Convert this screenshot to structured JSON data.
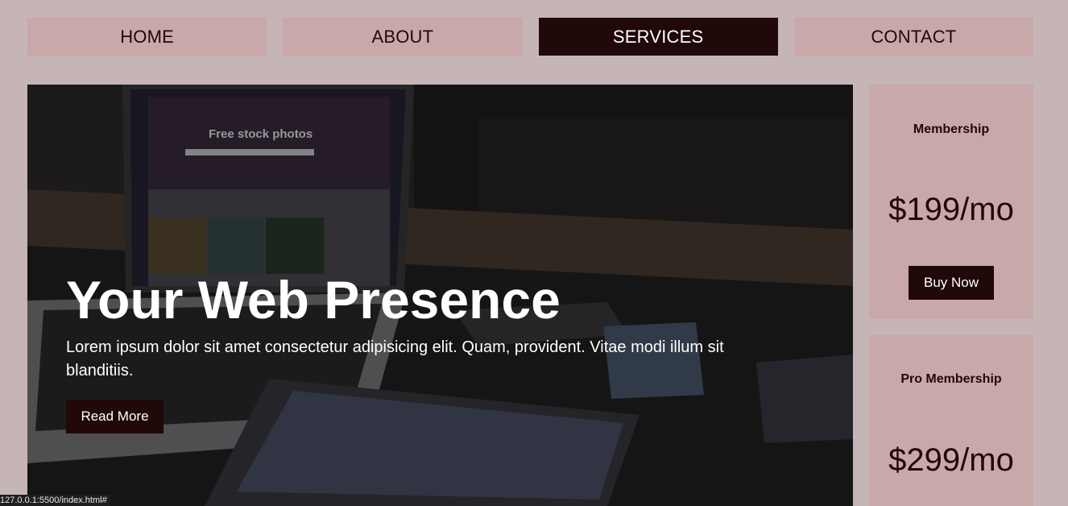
{
  "nav": {
    "items": [
      {
        "label": "HOME",
        "active": false
      },
      {
        "label": "ABOUT",
        "active": false
      },
      {
        "label": "SERVICES",
        "active": true
      },
      {
        "label": "CONTACT",
        "active": false
      }
    ]
  },
  "hero": {
    "title": "Your Web Presence",
    "text": "Lorem ipsum dolor sit amet consectetur adipisicing elit. Quam, provident. Vitae modi illum sit blanditiis.",
    "button_label": "Read More",
    "background_image": "laptop-phone-tablet-desk-photo",
    "laptop_screen_title": "Free stock photos"
  },
  "cards": [
    {
      "title": "Membership",
      "price": "$199/mo",
      "button_label": "Buy Now"
    },
    {
      "title": "Pro Membership",
      "price": "$299/mo"
    }
  ],
  "status_bar": {
    "url": "127.0.0.1:5500/index.html#"
  },
  "colors": {
    "page_bg": "#c6b5b6",
    "nav_bg": "#c9a8aa",
    "accent_dark": "#210809",
    "hero_text": "#ffffff"
  }
}
